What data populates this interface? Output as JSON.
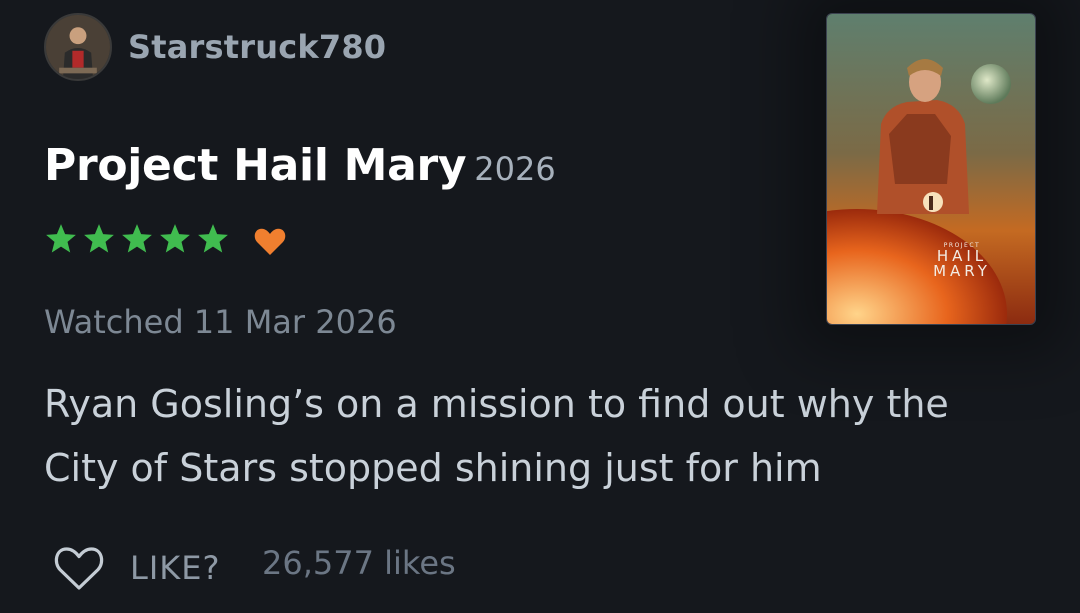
{
  "user": {
    "username": "Starstruck780"
  },
  "film": {
    "title": "Project Hail Mary",
    "year": "2026",
    "rating_stars": 5,
    "liked": true,
    "poster_lines": {
      "kicker": "PROJECT",
      "line1": "HAIL",
      "line2": "MARY"
    }
  },
  "review": {
    "watched": "Watched 11 Mar 2026",
    "text": "Ryan Gosling’s on a mission to find out why the City of Stars stopped shining just for him"
  },
  "actions": {
    "like_label": "LIKE?",
    "likes_count": "26,577 likes"
  },
  "colors": {
    "background": "#15181d",
    "star": "#40bc4f",
    "liked_heart": "#f07f2f",
    "username": "#9aa5b1"
  }
}
